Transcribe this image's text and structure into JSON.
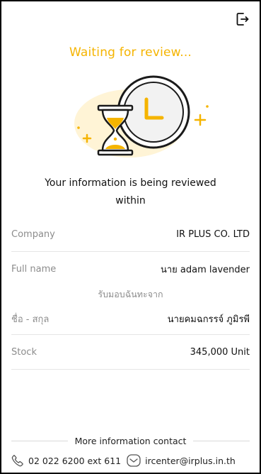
{
  "header": {
    "title": "Waiting for review...",
    "logout_icon": "logout-icon"
  },
  "illustration": {
    "icons": [
      "hourglass-icon",
      "clock-icon",
      "sparkle-icon"
    ],
    "accent_color": "#F5B400"
  },
  "message": {
    "line1": "Your information is being reviewed",
    "line2": "within"
  },
  "details": {
    "company": {
      "label": "Company",
      "value": "IR PLUS CO. LTD"
    },
    "full_name": {
      "label": "Full name",
      "value": "นาย adam lavender"
    },
    "received_from_caption": "รับมอบฉันทะจาก",
    "thai_name": {
      "label": "ชื่อ - สกุล",
      "value": "นายคมฉกรรจ์ ภูมิรพี"
    },
    "stock": {
      "label": "Stock",
      "value": "345,000 Unit"
    }
  },
  "contact": {
    "heading": "More information contact",
    "phone": "02 022 6200 ext 611",
    "email": "ircenter@irplus.in.th"
  }
}
